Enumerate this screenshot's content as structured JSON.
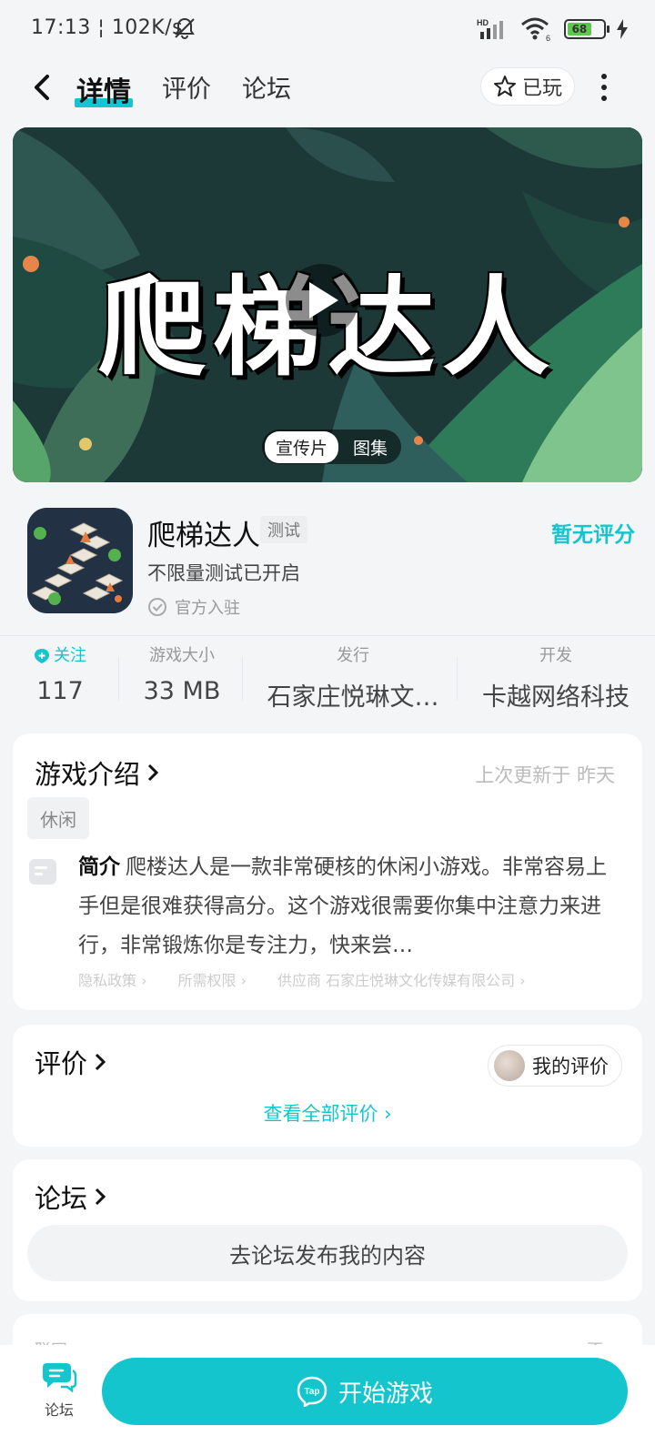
{
  "status_bar": {
    "time": "17:13",
    "speed": "102K/s",
    "network": "HD",
    "wifi_badge": "6",
    "battery": "68",
    "battery_level": 0.68
  },
  "nav": {
    "tabs": [
      "详情",
      "评价",
      "论坛"
    ],
    "active_tab": "详情",
    "played_label": "已玩"
  },
  "banner": {
    "title": "爬梯达人",
    "media_tabs": [
      "宣传片",
      "图集"
    ],
    "active_media": "宣传片"
  },
  "game": {
    "name": "爬梯达人",
    "badge": "测试",
    "score_text": "暂无评分",
    "subtitle": "不限量测试已开启",
    "official": "官方入驻"
  },
  "stats": {
    "follow_label": "关注",
    "follow_count": "117",
    "size_label": "游戏大小",
    "size_value": "33 MB",
    "publisher_label": "发行",
    "publisher_value": "石家庄悦琳文…",
    "developer_label": "开发",
    "developer_value": "卡越网络科技"
  },
  "intro": {
    "title": "游戏介绍",
    "updated": "上次更新于 昨天",
    "tag": "休闲",
    "desc_label": "简介",
    "desc_text": "爬楼达人是一款非常硬核的休闲小游戏。非常容易上手但是很难获得高分。这个游戏很需要你集中注意力来进行，非常锻炼你是专注力，快来尝…",
    "links": [
      "隐私政策 ›",
      "所需权限 ›",
      "供应商 石家庄悦琳文化传媒有限公司 ›"
    ]
  },
  "review": {
    "title": "评价",
    "my_review": "我的评价",
    "see_all": "查看全部评价 ›"
  },
  "forum": {
    "title": "论坛",
    "post_button": "去论坛发布我的内容"
  },
  "network_row": {
    "label": "联网",
    "value": "否 ›"
  },
  "bottom_bar": {
    "forum_label": "论坛",
    "start_button": "开始游戏",
    "tap_logo": "Tap"
  },
  "colors": {
    "accent": "#15c5ce",
    "background": "#f4f5f7"
  }
}
